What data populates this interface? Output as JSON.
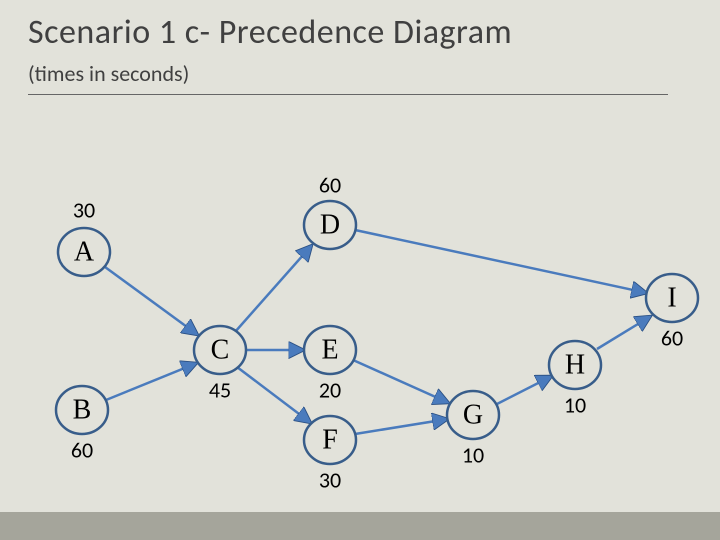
{
  "title": "Scenario 1 c- Precedence Diagram",
  "subtitle": "(times in seconds)",
  "chart_data": {
    "type": "diagram",
    "title": "Scenario 1 c- Precedence Diagram",
    "subtitle": "(times in seconds)",
    "nodes": [
      {
        "id": "A",
        "time": 30,
        "time_pos": "above"
      },
      {
        "id": "B",
        "time": 60,
        "time_pos": "below"
      },
      {
        "id": "C",
        "time": 45,
        "time_pos": "below"
      },
      {
        "id": "D",
        "time": 60,
        "time_pos": "above"
      },
      {
        "id": "E",
        "time": 20,
        "time_pos": "below"
      },
      {
        "id": "F",
        "time": 30,
        "time_pos": "below"
      },
      {
        "id": "G",
        "time": 10,
        "time_pos": "below"
      },
      {
        "id": "H",
        "time": 10,
        "time_pos": "below"
      },
      {
        "id": "I",
        "time": 60,
        "time_pos": "below"
      }
    ],
    "edges": [
      [
        "A",
        "C"
      ],
      [
        "B",
        "C"
      ],
      [
        "C",
        "D"
      ],
      [
        "C",
        "E"
      ],
      [
        "C",
        "F"
      ],
      [
        "D",
        "I"
      ],
      [
        "E",
        "G"
      ],
      [
        "F",
        "G"
      ],
      [
        "G",
        "H"
      ],
      [
        "H",
        "I"
      ]
    ]
  },
  "labels": {
    "A": "A",
    "B": "B",
    "C": "C",
    "D": "D",
    "E": "E",
    "F": "F",
    "G": "G",
    "H": "H",
    "I": "I",
    "tA": "30",
    "tB": "60",
    "tC": "45",
    "tD": "60",
    "tE": "20",
    "tF": "30",
    "tG": "10",
    "tH": "10",
    "tI": "60"
  }
}
